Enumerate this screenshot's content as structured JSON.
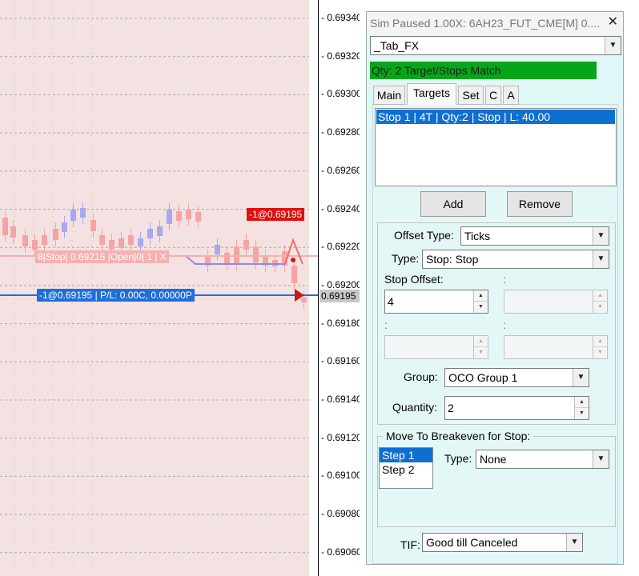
{
  "chart": {
    "price_ticks": [
      "0.69340",
      "0.69320",
      "0.69300",
      "0.69280",
      "0.69260",
      "0.69240",
      "0.69220",
      "0.69200",
      "0.69180",
      "0.69160",
      "0.69140",
      "0.69120",
      "0.69100",
      "0.69080",
      "0.69060"
    ],
    "current_price": "0.69195",
    "entry_flag": "-1@0.69195",
    "position_line_label": "-1@0.69195 | P/L: 0.00C, 0.00000P",
    "stop_line_label": "8|Stop| 0.69215 |Open|0| 1 | X",
    "colors": {
      "up_bar": "#a8a8f0",
      "down_bar": "#f5a3a3",
      "position_line": "#1e6fd9",
      "stop_line": "#f5b0b0",
      "flag_red": "#e01010"
    }
  },
  "panel": {
    "title": "Sim Paused 1.00X: 6AH23_FUT_CME[M]  0....",
    "close_icon": "✕",
    "template_dropdown": "_Tab_FX",
    "status": "Qty: 2 Target/Stops Match",
    "tabs": [
      "Main",
      "Targets",
      "Set",
      "C",
      "A"
    ],
    "active_tab": "Targets",
    "targets_list": [
      "Stop 1 | 4T | Qty:2 | Stop | L: 40.00"
    ],
    "add_button": "Add",
    "remove_button": "Remove",
    "offset_type_label": "Offset Type:",
    "offset_type_value": "Ticks",
    "type_label": "Type:",
    "type_value": "Stop: Stop",
    "stop_offset_label": "Stop Offset:",
    "stop_offset_value": "4",
    "blank_colon": ":",
    "group_label": "Group:",
    "group_value": "OCO Group 1",
    "quantity_label": "Quantity:",
    "quantity_value": "2",
    "breakeven_title": "Move To Breakeven for Stop:",
    "breakeven_steps": [
      "Step 1",
      "Step 2"
    ],
    "breakeven_type_label": "Type:",
    "breakeven_type_value": "None",
    "tif_label": "TIF:",
    "tif_value": "Good till Canceled"
  }
}
